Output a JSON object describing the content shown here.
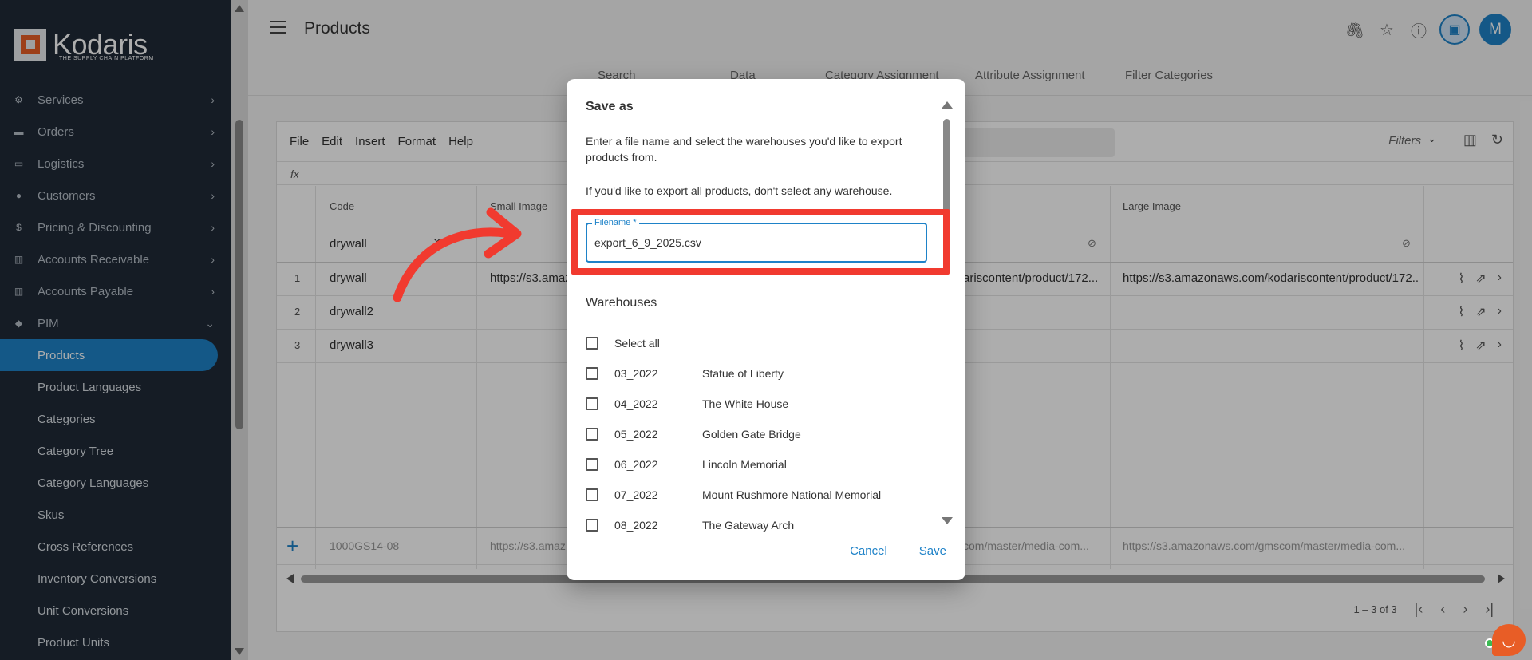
{
  "app": {
    "name": "Kodaris",
    "tagline": "THE SUPPLY CHAIN PLATFORM"
  },
  "sidebar": {
    "items": [
      {
        "label": "Services",
        "icon": "gears-icon"
      },
      {
        "label": "Orders",
        "icon": "truck-icon"
      },
      {
        "label": "Logistics",
        "icon": "shipping-icon"
      },
      {
        "label": "Customers",
        "icon": "people-icon"
      },
      {
        "label": "Pricing & Discounting",
        "icon": "dollar-icon"
      },
      {
        "label": "Accounts Receivable",
        "icon": "bank-icon"
      },
      {
        "label": "Accounts Payable",
        "icon": "bank-icon"
      },
      {
        "label": "PIM",
        "icon": "tag-icon"
      }
    ],
    "pim_sub": [
      "Products",
      "Product Languages",
      "Categories",
      "Category Tree",
      "Category Languages",
      "Skus",
      "Cross References",
      "Inventory Conversions",
      "Unit Conversions",
      "Product Units"
    ]
  },
  "header": {
    "title": "Products",
    "avatar_initial": "M"
  },
  "tabs": [
    "Search",
    "Data",
    "Category Assignment",
    "Attribute Assignment",
    "Filter Categories"
  ],
  "grid": {
    "menu": [
      "File",
      "Edit",
      "Insert",
      "Format",
      "Help"
    ],
    "filters_label": "Filters",
    "fx": "fx",
    "columns": [
      "Code",
      "Small Image",
      "Large Image"
    ],
    "filter_value": "drywall",
    "rows": [
      {
        "num": "1",
        "code": "drywall",
        "small_image": "https://s3.amaz",
        "medium": "ariscontent/product/172...",
        "large_image": "https://s3.amazonaws.com/kodariscontent/product/172..."
      },
      {
        "num": "2",
        "code": "drywall2",
        "small_image": "",
        "medium": "",
        "large_image": ""
      },
      {
        "num": "3",
        "code": "drywall3",
        "small_image": "",
        "medium": "",
        "large_image": ""
      }
    ],
    "footer": {
      "code": "1000GS14-08",
      "small_image": "https://s3.amaz",
      "medium": "com/master/media-com...",
      "large_image": "https://s3.amazonaws.com/gmscom/master/media-com..."
    },
    "pager_text": "1 – 3 of 3"
  },
  "dialog": {
    "title": "Save as",
    "description": "Enter a file name and select the warehouses you'd like to export products from.",
    "note": "If you'd like to export all products, don't select any warehouse.",
    "field_label": "Filename *",
    "filename": "export_6_9_2025.csv",
    "warehouses_title": "Warehouses",
    "select_all": "Select all",
    "warehouses": [
      {
        "code": "03_2022",
        "name": "Statue of Liberty"
      },
      {
        "code": "04_2022",
        "name": "The White House"
      },
      {
        "code": "05_2022",
        "name": "Golden Gate Bridge"
      },
      {
        "code": "06_2022",
        "name": "Lincoln Memorial"
      },
      {
        "code": "07_2022",
        "name": "Mount Rushmore National Memorial"
      },
      {
        "code": "08_2022",
        "name": "The Gateway Arch"
      }
    ],
    "cancel_label": "Cancel",
    "save_label": "Save"
  },
  "colors": {
    "accent": "#1e82c8",
    "highlight": "#f13a2f",
    "sidebar_bg": "#1f2a37",
    "brand": "#e85d26"
  }
}
